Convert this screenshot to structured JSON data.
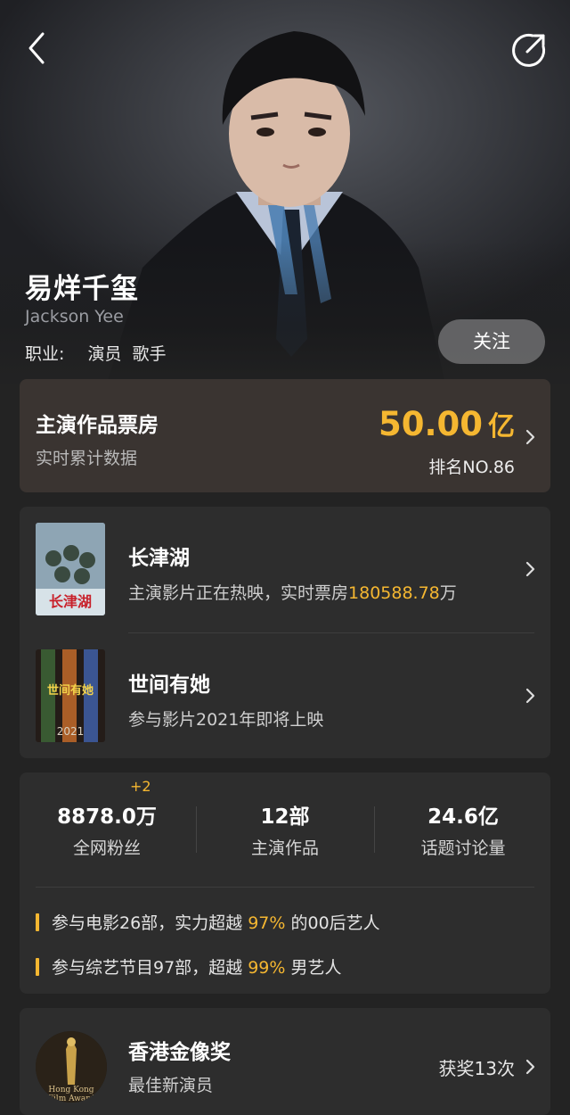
{
  "header": {
    "back_icon": "chevron-left-icon",
    "share_icon": "share-icon"
  },
  "artist": {
    "name": "易烊千玺",
    "english_name": "Jackson Yee",
    "profession_label": "职业:",
    "professions": [
      "演员",
      "歌手"
    ],
    "follow_label": "关注"
  },
  "box_office": {
    "title": "主演作品票房",
    "subtitle": "实时累计数据",
    "value": "50.00",
    "unit": "亿",
    "rank": "排名NO.86"
  },
  "movies": [
    {
      "title": "长津湖",
      "subtitle_prefix": "主演影片正在热映，实时票房",
      "gross": "180588.78",
      "gross_unit": "万",
      "poster_text": "长津湖"
    },
    {
      "title": "世间有她",
      "subtitle": "参与影片2021年即将上映",
      "poster_text": "2021"
    }
  ],
  "stats": {
    "fans_delta": "+2",
    "items": [
      {
        "value": "8878.0万",
        "label": "全网粉丝"
      },
      {
        "value": "12部",
        "label": "主演作品"
      },
      {
        "value": "24.6亿",
        "label": "话题讨论量"
      }
    ],
    "facts": [
      {
        "prefix": "参与电影26部，实力超越 ",
        "pct": "97%",
        "suffix": " 的00后艺人"
      },
      {
        "prefix": "参与综艺节目97部，超越 ",
        "pct": "99%",
        "suffix": " 男艺人"
      }
    ]
  },
  "award": {
    "title": "香港金像奖",
    "subtitle": "最佳新演员",
    "count": "获奖13次",
    "icon_text": [
      "Hong Kong",
      "Film Award"
    ]
  },
  "colors": {
    "accent": "#f5b731",
    "background": "#232323",
    "card": "#2d2d2d",
    "box_office_card": "#3a3431"
  }
}
